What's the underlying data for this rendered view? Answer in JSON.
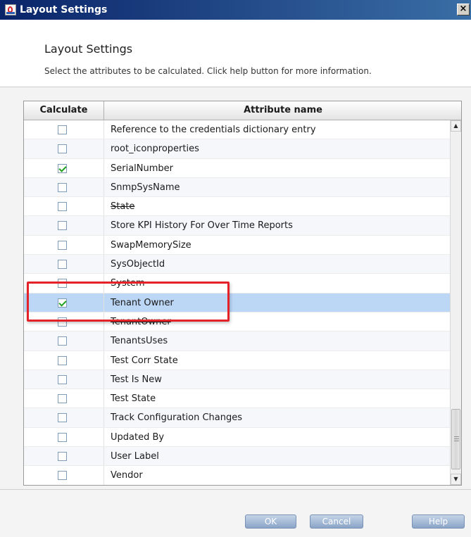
{
  "window": {
    "title": "Layout Settings",
    "close_glyph": "×"
  },
  "header": {
    "title": "Layout Settings",
    "description": "Select the attributes to be calculated. Click help button for more information."
  },
  "table": {
    "columns": [
      "Calculate",
      "Attribute name"
    ],
    "rows": [
      {
        "name": "Reference to the credentials dictionary entry",
        "checked": false
      },
      {
        "name": "root_iconproperties",
        "checked": false
      },
      {
        "name": "SerialNumber",
        "checked": true
      },
      {
        "name": "SnmpSysName",
        "checked": false
      },
      {
        "name": "State",
        "checked": false,
        "strike": true
      },
      {
        "name": "Store KPI History For Over Time Reports",
        "checked": false
      },
      {
        "name": "SwapMemorySize",
        "checked": false
      },
      {
        "name": "SysObjectId",
        "checked": false
      },
      {
        "name": "System",
        "checked": false,
        "strike": true
      },
      {
        "name": "Tenant Owner",
        "checked": true,
        "selected": true
      },
      {
        "name": "TenantOwner",
        "checked": false,
        "strike": true
      },
      {
        "name": "TenantsUses",
        "checked": false
      },
      {
        "name": "Test Corr State",
        "checked": false
      },
      {
        "name": "Test Is New",
        "checked": false
      },
      {
        "name": "Test State",
        "checked": false
      },
      {
        "name": "Track Configuration Changes",
        "checked": false
      },
      {
        "name": "Updated By",
        "checked": false
      },
      {
        "name": "User Label",
        "checked": false
      },
      {
        "name": "Vendor",
        "checked": false
      }
    ]
  },
  "buttons": {
    "ok": "OK",
    "cancel": "Cancel",
    "help": "Help"
  },
  "colors": {
    "title_bar": "#0a246a",
    "highlight": "#e4222a",
    "selected_row": "#bcd6f5",
    "check": "#21a121"
  },
  "icons": [
    "app-icon",
    "close-icon",
    "checkbox-icon",
    "scroll-up-arrow-icon",
    "scroll-down-arrow-icon"
  ]
}
